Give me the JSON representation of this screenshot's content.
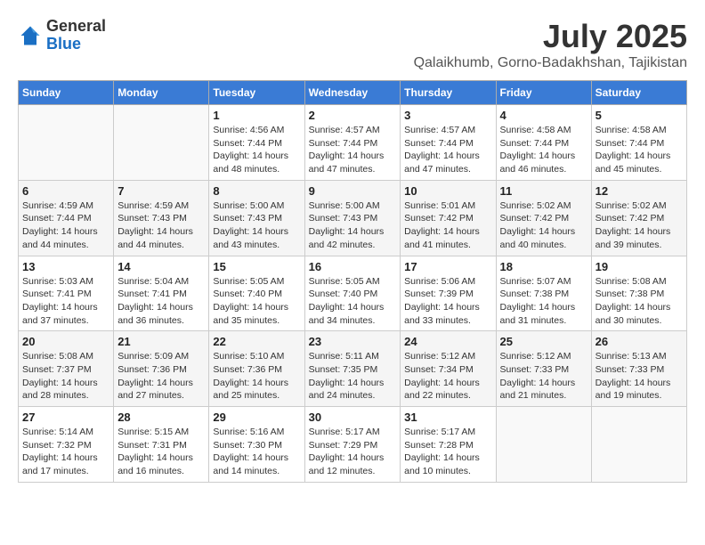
{
  "logo": {
    "general": "General",
    "blue": "Blue"
  },
  "header": {
    "month": "July 2025",
    "location": "Qalaikhumb, Gorno-Badakhshan, Tajikistan"
  },
  "weekdays": [
    "Sunday",
    "Monday",
    "Tuesday",
    "Wednesday",
    "Thursday",
    "Friday",
    "Saturday"
  ],
  "weeks": [
    [
      {
        "day": "",
        "info": ""
      },
      {
        "day": "",
        "info": ""
      },
      {
        "day": "1",
        "info": "Sunrise: 4:56 AM\nSunset: 7:44 PM\nDaylight: 14 hours and 48 minutes."
      },
      {
        "day": "2",
        "info": "Sunrise: 4:57 AM\nSunset: 7:44 PM\nDaylight: 14 hours and 47 minutes."
      },
      {
        "day": "3",
        "info": "Sunrise: 4:57 AM\nSunset: 7:44 PM\nDaylight: 14 hours and 47 minutes."
      },
      {
        "day": "4",
        "info": "Sunrise: 4:58 AM\nSunset: 7:44 PM\nDaylight: 14 hours and 46 minutes."
      },
      {
        "day": "5",
        "info": "Sunrise: 4:58 AM\nSunset: 7:44 PM\nDaylight: 14 hours and 45 minutes."
      }
    ],
    [
      {
        "day": "6",
        "info": "Sunrise: 4:59 AM\nSunset: 7:44 PM\nDaylight: 14 hours and 44 minutes."
      },
      {
        "day": "7",
        "info": "Sunrise: 4:59 AM\nSunset: 7:43 PM\nDaylight: 14 hours and 44 minutes."
      },
      {
        "day": "8",
        "info": "Sunrise: 5:00 AM\nSunset: 7:43 PM\nDaylight: 14 hours and 43 minutes."
      },
      {
        "day": "9",
        "info": "Sunrise: 5:00 AM\nSunset: 7:43 PM\nDaylight: 14 hours and 42 minutes."
      },
      {
        "day": "10",
        "info": "Sunrise: 5:01 AM\nSunset: 7:42 PM\nDaylight: 14 hours and 41 minutes."
      },
      {
        "day": "11",
        "info": "Sunrise: 5:02 AM\nSunset: 7:42 PM\nDaylight: 14 hours and 40 minutes."
      },
      {
        "day": "12",
        "info": "Sunrise: 5:02 AM\nSunset: 7:42 PM\nDaylight: 14 hours and 39 minutes."
      }
    ],
    [
      {
        "day": "13",
        "info": "Sunrise: 5:03 AM\nSunset: 7:41 PM\nDaylight: 14 hours and 37 minutes."
      },
      {
        "day": "14",
        "info": "Sunrise: 5:04 AM\nSunset: 7:41 PM\nDaylight: 14 hours and 36 minutes."
      },
      {
        "day": "15",
        "info": "Sunrise: 5:05 AM\nSunset: 7:40 PM\nDaylight: 14 hours and 35 minutes."
      },
      {
        "day": "16",
        "info": "Sunrise: 5:05 AM\nSunset: 7:40 PM\nDaylight: 14 hours and 34 minutes."
      },
      {
        "day": "17",
        "info": "Sunrise: 5:06 AM\nSunset: 7:39 PM\nDaylight: 14 hours and 33 minutes."
      },
      {
        "day": "18",
        "info": "Sunrise: 5:07 AM\nSunset: 7:38 PM\nDaylight: 14 hours and 31 minutes."
      },
      {
        "day": "19",
        "info": "Sunrise: 5:08 AM\nSunset: 7:38 PM\nDaylight: 14 hours and 30 minutes."
      }
    ],
    [
      {
        "day": "20",
        "info": "Sunrise: 5:08 AM\nSunset: 7:37 PM\nDaylight: 14 hours and 28 minutes."
      },
      {
        "day": "21",
        "info": "Sunrise: 5:09 AM\nSunset: 7:36 PM\nDaylight: 14 hours and 27 minutes."
      },
      {
        "day": "22",
        "info": "Sunrise: 5:10 AM\nSunset: 7:36 PM\nDaylight: 14 hours and 25 minutes."
      },
      {
        "day": "23",
        "info": "Sunrise: 5:11 AM\nSunset: 7:35 PM\nDaylight: 14 hours and 24 minutes."
      },
      {
        "day": "24",
        "info": "Sunrise: 5:12 AM\nSunset: 7:34 PM\nDaylight: 14 hours and 22 minutes."
      },
      {
        "day": "25",
        "info": "Sunrise: 5:12 AM\nSunset: 7:33 PM\nDaylight: 14 hours and 21 minutes."
      },
      {
        "day": "26",
        "info": "Sunrise: 5:13 AM\nSunset: 7:33 PM\nDaylight: 14 hours and 19 minutes."
      }
    ],
    [
      {
        "day": "27",
        "info": "Sunrise: 5:14 AM\nSunset: 7:32 PM\nDaylight: 14 hours and 17 minutes."
      },
      {
        "day": "28",
        "info": "Sunrise: 5:15 AM\nSunset: 7:31 PM\nDaylight: 14 hours and 16 minutes."
      },
      {
        "day": "29",
        "info": "Sunrise: 5:16 AM\nSunset: 7:30 PM\nDaylight: 14 hours and 14 minutes."
      },
      {
        "day": "30",
        "info": "Sunrise: 5:17 AM\nSunset: 7:29 PM\nDaylight: 14 hours and 12 minutes."
      },
      {
        "day": "31",
        "info": "Sunrise: 5:17 AM\nSunset: 7:28 PM\nDaylight: 14 hours and 10 minutes."
      },
      {
        "day": "",
        "info": ""
      },
      {
        "day": "",
        "info": ""
      }
    ]
  ]
}
